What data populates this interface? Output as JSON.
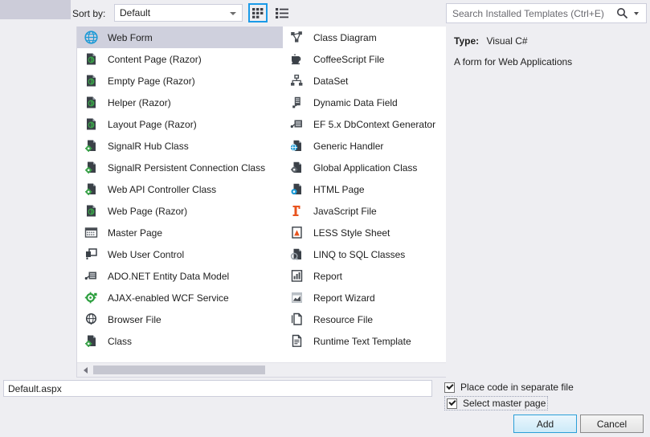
{
  "toolbar": {
    "sort_by_label": "Sort by:",
    "sort_by_value": "Default",
    "view_grid_name": "medium-icons-view",
    "view_list_name": "list-view"
  },
  "search": {
    "placeholder": "Search Installed Templates (Ctrl+E)"
  },
  "templates": {
    "column1": [
      {
        "label": "Web Form",
        "icon": "globe-icon",
        "selected": true
      },
      {
        "label": "Content Page (Razor)",
        "icon": "razor-page-icon",
        "selected": false
      },
      {
        "label": "Empty Page (Razor)",
        "icon": "razor-page-icon",
        "selected": false
      },
      {
        "label": "Helper (Razor)",
        "icon": "razor-page-icon",
        "selected": false
      },
      {
        "label": "Layout Page (Razor)",
        "icon": "razor-page-icon",
        "selected": false
      },
      {
        "label": "SignalR Hub Class",
        "icon": "class-gear-icon",
        "selected": false
      },
      {
        "label": "SignalR Persistent Connection Class",
        "icon": "class-gear-icon",
        "selected": false
      },
      {
        "label": "Web API Controller Class",
        "icon": "class-gear-icon",
        "selected": false
      },
      {
        "label": "Web Page (Razor)",
        "icon": "razor-page-icon",
        "selected": false
      },
      {
        "label": "Master Page",
        "icon": "master-page-icon",
        "selected": false
      },
      {
        "label": "Web User Control",
        "icon": "user-control-icon",
        "selected": false
      },
      {
        "label": "ADO.NET Entity Data Model",
        "icon": "entity-model-icon",
        "selected": false
      },
      {
        "label": "AJAX-enabled WCF Service",
        "icon": "wcf-service-icon",
        "selected": false
      },
      {
        "label": "Browser File",
        "icon": "browser-file-icon",
        "selected": false
      },
      {
        "label": "Class",
        "icon": "class-gear-icon",
        "selected": false
      }
    ],
    "column2": [
      {
        "label": "Class Diagram",
        "icon": "class-diagram-icon",
        "selected": false
      },
      {
        "label": "CoffeeScript File",
        "icon": "coffee-cup-icon",
        "selected": false
      },
      {
        "label": "DataSet",
        "icon": "dataset-icon",
        "selected": false
      },
      {
        "label": "Dynamic Data Field",
        "icon": "dynamic-data-field-icon",
        "selected": false
      },
      {
        "label": "EF 5.x DbContext Generator",
        "icon": "entity-model-icon",
        "selected": false
      },
      {
        "label": "Generic Handler",
        "icon": "generic-handler-icon",
        "selected": false
      },
      {
        "label": "Global Application Class",
        "icon": "global-app-class-icon",
        "selected": false
      },
      {
        "label": "HTML Page",
        "icon": "html-page-icon",
        "selected": false
      },
      {
        "label": "JavaScript File",
        "icon": "javascript-file-icon",
        "selected": false
      },
      {
        "label": "LESS Style Sheet",
        "icon": "less-stylesheet-icon",
        "selected": false
      },
      {
        "label": "LINQ to SQL Classes",
        "icon": "linq-sql-icon",
        "selected": false
      },
      {
        "label": "Report",
        "icon": "report-icon",
        "selected": false
      },
      {
        "label": "Report Wizard",
        "icon": "report-wizard-icon",
        "selected": false
      },
      {
        "label": "Resource File",
        "icon": "resource-file-icon",
        "selected": false
      },
      {
        "label": "Runtime Text Template",
        "icon": "text-template-icon",
        "selected": false
      }
    ]
  },
  "details": {
    "type_label": "Type:",
    "type_value": "Visual C#",
    "description": "A form for Web Applications"
  },
  "bottom": {
    "name_value": "Default.aspx",
    "checkbox_place_code": "Place code in separate file",
    "checkbox_select_master": "Select master page",
    "add_label": "Add",
    "cancel_label": "Cancel"
  },
  "colors": {
    "accent": "#1a9ae8",
    "selection": "#cfd0dd",
    "panel_bg": "#eeeef2",
    "list_bg": "#ffffff"
  }
}
